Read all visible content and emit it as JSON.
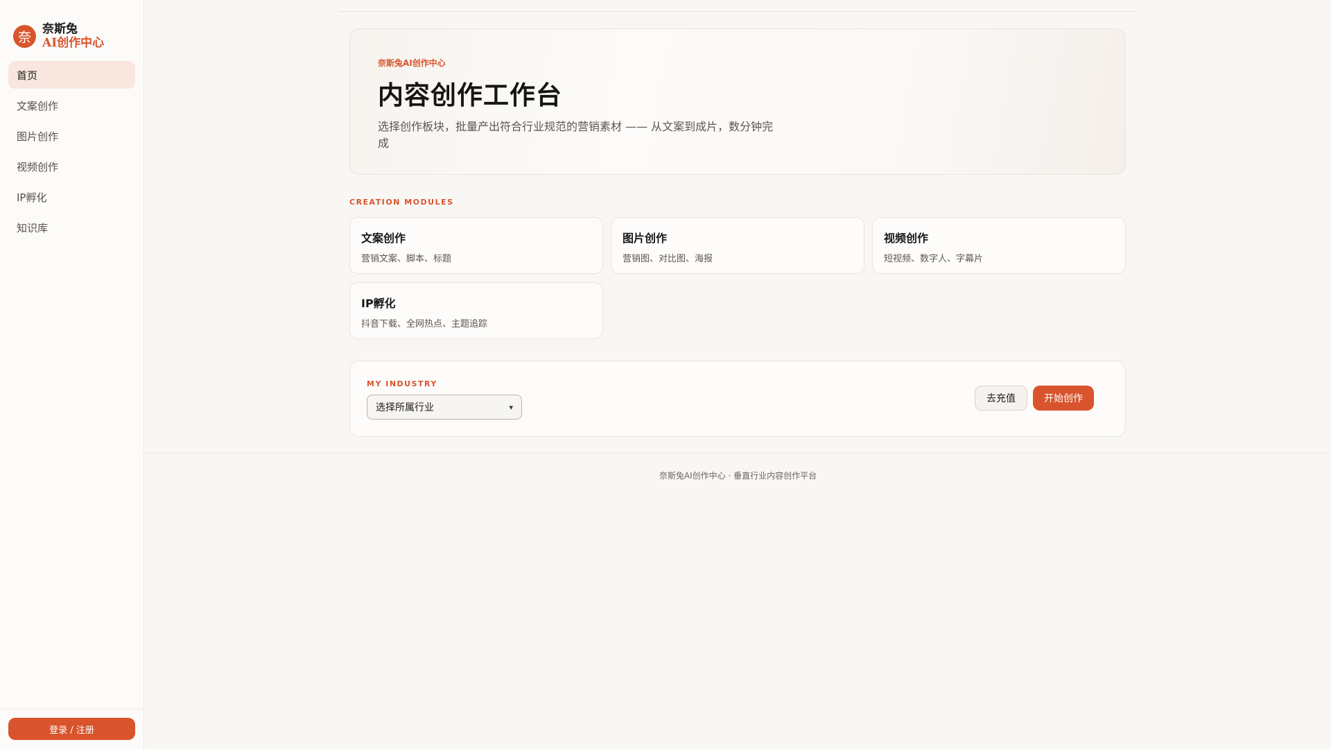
{
  "brand": {
    "logo_char": "奈",
    "name": "奈斯兔",
    "sub": "AI创作中心"
  },
  "sidebar": {
    "items": [
      {
        "label": "首页",
        "active": true
      },
      {
        "label": "文案创作"
      },
      {
        "label": "图片创作"
      },
      {
        "label": "视频创作"
      },
      {
        "label": "IP孵化"
      },
      {
        "label": "知识库"
      }
    ],
    "login_label": "登录 / 注册"
  },
  "hero": {
    "eyebrow": "奈斯兔AI创作中心",
    "title": "内容创作工作台",
    "description": "选择创作板块，批量产出符合行业规范的营销素材 —— 从文案到成片，数分钟完成"
  },
  "modules": {
    "label": "CREATION MODULES",
    "cards": [
      {
        "title": "文案创作",
        "desc": "营销文案、脚本、标题"
      },
      {
        "title": "图片创作",
        "desc": "营销图、对比图、海报"
      },
      {
        "title": "视频创作",
        "desc": "短视频、数字人、字幕片"
      },
      {
        "title": "IP孵化",
        "desc": "抖音下载、全网热点、主题追踪"
      }
    ]
  },
  "industry": {
    "label": "MY INDUSTRY",
    "select_value": "选择所属行业",
    "recharge_label": "去充值",
    "start_label": "开始创作"
  },
  "footer": {
    "text": "奈斯兔AI创作中心 · 垂直行业内容创作平台"
  },
  "colors": {
    "accent": "#d9542c",
    "active_nav_bg": "#f8e6df",
    "page_bg": "#f9f7f4"
  }
}
